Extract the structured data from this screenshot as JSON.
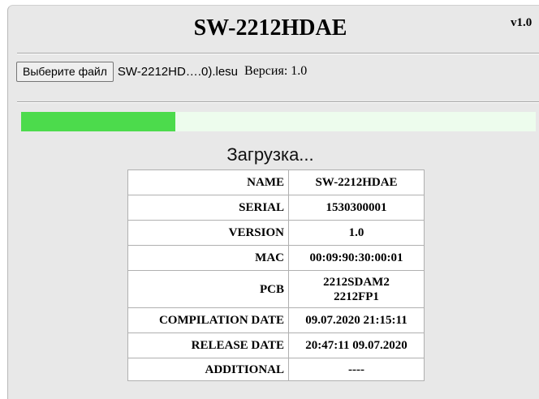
{
  "header": {
    "title": "SW-2212HDAE",
    "version_tag": "v1.0"
  },
  "file_picker": {
    "button_label": "Выберите файл",
    "file_name": "SW-2212HD….0).lesu",
    "firmware_version": "Версия: 1.0"
  },
  "progress": {
    "fraction": 0.3,
    "status": "Загрузка..."
  },
  "colors": {
    "progress_fill": "#4cdb4c",
    "progress_track": "#edfced",
    "panel_background": "#e8e8e8"
  },
  "device_info": {
    "rows": [
      {
        "key": "NAME",
        "value": "SW-2212HDAE"
      },
      {
        "key": "SERIAL",
        "value": "1530300001"
      },
      {
        "key": "VERSION",
        "value": "1.0"
      },
      {
        "key": "MAC",
        "value": "00:09:90:30:00:01"
      },
      {
        "key": "PCB",
        "value": "2212SDAM2",
        "value2": "2212FP1"
      },
      {
        "key": "COMPILATION DATE",
        "value": "09.07.2020 21:15:11"
      },
      {
        "key": "RELEASE DATE",
        "value": "20:47:11 09.07.2020"
      },
      {
        "key": "ADDITIONAL",
        "value": "----"
      }
    ]
  }
}
